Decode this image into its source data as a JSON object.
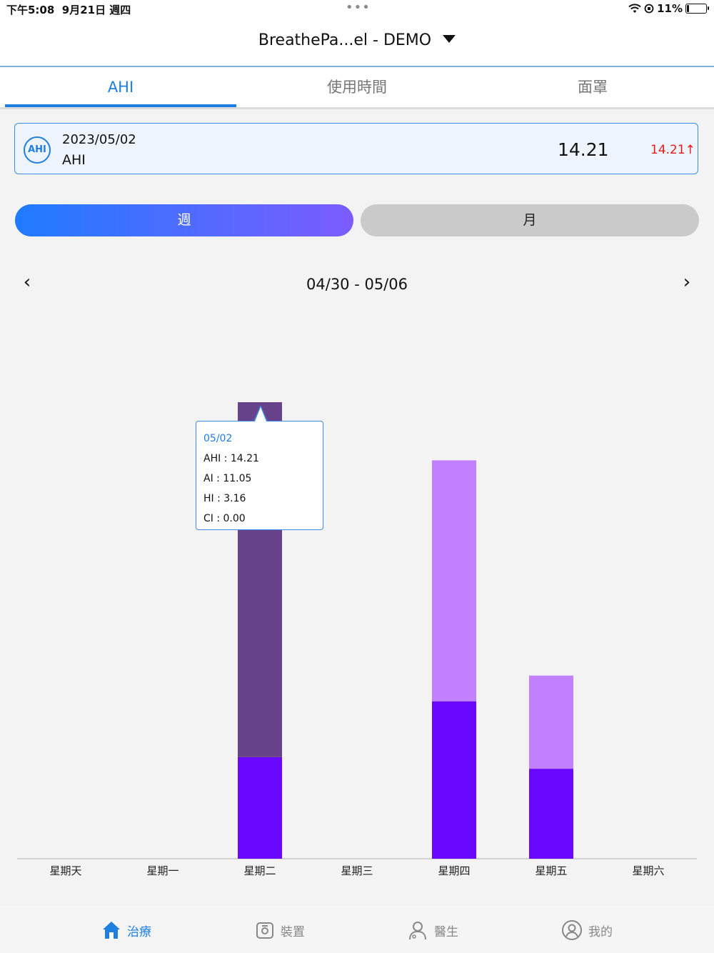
{
  "status_bar": {
    "time": "下午5:08",
    "date": "9月21日 週四",
    "dots": "•••",
    "battery": "11%"
  },
  "header": {
    "device_name": "BreathePa...el - DEMO"
  },
  "tabs": [
    {
      "label": "AHI",
      "active": true
    },
    {
      "label": "使用時間",
      "active": false
    },
    {
      "label": "面罩",
      "active": false
    }
  ],
  "summary": {
    "badge": "AHI",
    "date": "2023/05/02",
    "label": "AHI",
    "value": "14.21",
    "change": "14.21↑",
    "change_color": "#e21b1b"
  },
  "period_toggle": {
    "week": "週",
    "month": "月",
    "selected": "week"
  },
  "range": {
    "prev_icon": "‹",
    "label": "04/30 - 05/06",
    "next_icon": "›"
  },
  "tooltip": {
    "date": "05/02",
    "ahi": "AHI : 14.21",
    "ai": "AI : 11.05",
    "hi": "HI : 3.16",
    "ci": "CI : 0.00"
  },
  "chart_data": {
    "type": "bar",
    "stacked": true,
    "categories": [
      "星期天",
      "星期一",
      "星期二",
      "星期三",
      "星期四",
      "星期五",
      "星期六"
    ],
    "series": [
      {
        "name": "HI",
        "values": [
          0,
          0,
          3.16,
          0,
          4.9,
          2.8
        ],
        "color": "#6a08ff"
      },
      {
        "name": "AI",
        "values": [
          0,
          0,
          11.05,
          0,
          7.5,
          2.9
        ],
        "color": "#c180ff"
      }
    ],
    "highlight": {
      "index": 2,
      "color": "#66438a"
    },
    "ylim": [
      0,
      14.21
    ],
    "grid": false
  },
  "tabbar": [
    {
      "label": "治療",
      "icon": "home-icon",
      "active": true
    },
    {
      "label": "裝置",
      "icon": "device-icon",
      "active": false
    },
    {
      "label": "醫生",
      "icon": "doctor-icon",
      "active": false
    },
    {
      "label": "我的",
      "icon": "profile-icon",
      "active": false
    }
  ],
  "colors": {
    "accent": "#1f7fe0",
    "alert": "#e21b1b"
  }
}
